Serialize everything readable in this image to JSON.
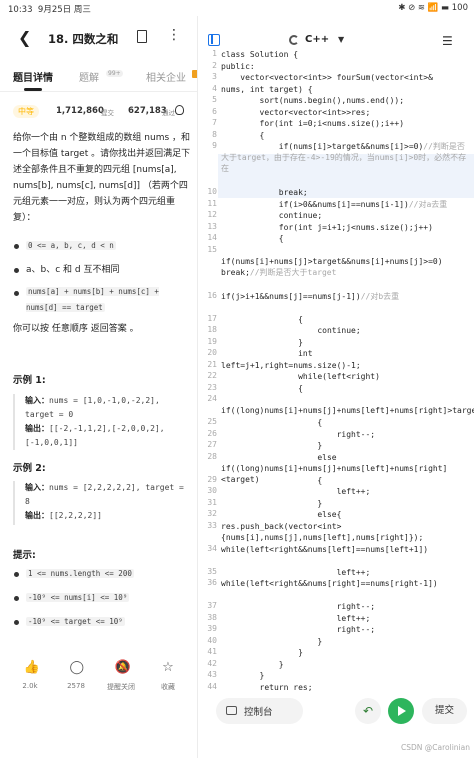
{
  "status_bar": {
    "time": "10:33",
    "date": "9月25日 周三",
    "indicators": "✱ ⊘ ≋ 📶 ▬ 100"
  },
  "header": {
    "title": "18. 四数之和"
  },
  "tabs": [
    {
      "label": "题目详情"
    },
    {
      "label": "题解",
      "badge": "99+"
    },
    {
      "label": "相关企业"
    }
  ],
  "meta": {
    "difficulty": "中等",
    "passed": "1,712,860",
    "passed_label": "提交",
    "submissions": "627,183",
    "submissions_label": "通过"
  },
  "description": {
    "p1": "给你一个由 n 个整数组成的数组 nums ，和一个目标值 target 。请你找出并返回满足下述全部条件且不重复的四元组 [nums[a], nums[b], nums[c], nums[d]] （若两个四元组元素一一对应，则认为两个四元组重复）：",
    "bullets": [
      "0 <= a, b, c, d < n",
      "a、b、c 和 d 互不相同",
      "nums[a] + nums[b] + nums[c] + nums[d] == target"
    ],
    "p2": "你可以按 任意顺序 返回答案 。"
  },
  "examples": [
    {
      "title": "示例 1:",
      "input_label": "输入：",
      "input": "nums = [1,0,-1,0,-2,2], target = 0",
      "output_label": "输出：",
      "output": "[[-2,-1,1,2],[-2,0,0,2],[-1,0,0,1]]"
    },
    {
      "title": "示例 2:",
      "input_label": "输入：",
      "input": "nums = [2,2,2,2,2], target = 8",
      "output_label": "输出：",
      "output": "[[2,2,2,2]]"
    }
  ],
  "hints": {
    "title": "提示:",
    "items": [
      "1 <= nums.length <= 200",
      "-10⁹ <= nums[i] <= 10⁹",
      "-10⁹ <= target <= 10⁹"
    ]
  },
  "bottom_bar": [
    {
      "icon": "thumbs-up-icon",
      "label": "2.0k"
    },
    {
      "icon": "comment-icon",
      "label": "2578"
    },
    {
      "icon": "bell-off-icon",
      "label": "提醒关闭"
    },
    {
      "icon": "star-icon",
      "label": "收藏"
    }
  ],
  "editor": {
    "language": "C++",
    "line_numbers": [
      "1",
      "2",
      "3",
      "4",
      "5",
      "6",
      "7",
      "8",
      "9",
      "10",
      "11",
      "12",
      "13",
      "14",
      "15",
      "16",
      "17",
      "18",
      "19",
      "20",
      "21",
      "22",
      "23",
      "24",
      "25",
      "26",
      "27",
      "28",
      "29",
      "30",
      "31",
      "32",
      "33",
      "34",
      "35",
      "36",
      "37",
      "38",
      "39",
      "40",
      "41",
      "42",
      "43",
      "44",
      "45",
      "46"
    ],
    "code": [
      "class Solution {",
      "public:",
      "    vector<vector<int>> fourSum(vector<int>&",
      "nums, int target) {",
      "        sort(nums.begin(),nums.end());",
      "        vector<vector<int>>res;",
      "        for(int i=0;i<nums.size();i++)",
      "        {",
      "            if(nums[i]>target&&nums[i]>=0)//判断是否大于target，由于存在-4>-19的情况，当nums[i]>0时，必然不存在",
      "            break;",
      "            if(i>0&&nums[i]==nums[i-1])//对a去重",
      "            continue;",
      "            for(int j=i+1;j<nums.size();j++)",
      "            {",
      "                if(nums[i]+nums[j]>target&&nums[i]+nums[j]>=0) break;//判断是否大于target",
      "if(j>i+1&&nums[j]==nums[j-1])//对b去重",
      "                {",
      "                    continue;",
      "                }",
      "                int",
      "left=j+1,right=nums.size()-1;",
      "                while(left<right)",
      "                {",
      "                    if((long)nums[i]+nums[j]+nums[left]+nums[right]>target)",
      "                    {",
      "                        right--;",
      "                    }",
      "                    else if((long)nums[i]+nums[j]+nums[left]+nums[right]<target)",
      "                    {",
      "                        left++;",
      "                    }",
      "                    else{",
      "res.push_back(vector<int>{nums[i],nums[j],nums[left],nums[right]});",
      "while(left<right&&nums[left]==nums[left+1])",
      "                        left++;",
      "while(left<right&&nums[right]==nums[right-1])",
      "                        right--;",
      "                        left++;",
      "                        right--;",
      "                    }",
      "                }",
      "            }",
      "        }",
      "        return res;",
      "    }",
      "};"
    ]
  },
  "actions": {
    "console": "控制台",
    "undo": "↶",
    "submit": "提交"
  },
  "watermark": "CSDN @Carolinian"
}
